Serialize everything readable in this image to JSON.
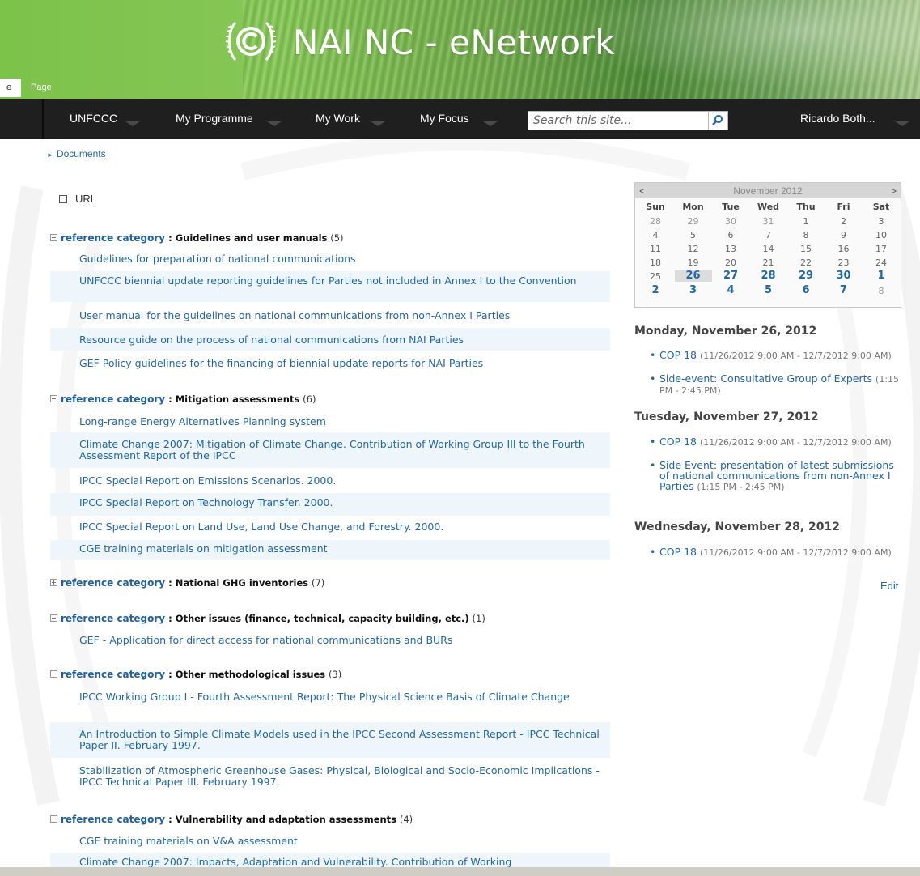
{
  "site": {
    "title": "NAI NC - eNetwork",
    "ribbon_tab_left": "e",
    "ribbon_tab_page": "Page"
  },
  "nav": {
    "items": [
      {
        "label": "UNFCCC"
      },
      {
        "label": "My Programme"
      },
      {
        "label": "My Work"
      },
      {
        "label": "My Focus"
      }
    ],
    "search_placeholder": "Search this site...",
    "user": "Ricardo Both..."
  },
  "breadcrumb": "Documents",
  "filter": {
    "url_label": "URL"
  },
  "groups": [
    {
      "category_label": "reference category",
      "separator": " : ",
      "name": "Guidelines and user manuals",
      "count": "(5)",
      "expanded": true,
      "items": [
        "Guidelines for preparation of national communications",
        "UNFCCC biennial update reporting guidelines for Parties not included in Annex I to the Convention",
        "User manual for the guidelines on national communications from non-Annex I Parties",
        "Resource guide on the process of national communications from NAI Parties",
        "GEF Policy guidelines for the financing of biennial update reports for NAI Parties"
      ]
    },
    {
      "category_label": "reference category",
      "separator": " : ",
      "name": "Mitigation assessments",
      "count": "(6)",
      "expanded": true,
      "items": [
        "Long-range Energy Alternatives Planning system",
        "Climate Change 2007: Mitigation of Climate Change. Contribution of Working Group III to the Fourth Assessment Report of the IPCC",
        "IPCC Special Report on Emissions Scenarios. 2000.",
        "IPCC Special Report on Technology Transfer. 2000.",
        "IPCC Special Report on Land Use, Land Use Change, and Forestry. 2000.",
        "CGE training materials on mitigation assessment"
      ]
    },
    {
      "category_label": "reference category",
      "separator": " : ",
      "name": "National GHG inventories",
      "count": "(7)",
      "expanded": false,
      "items": []
    },
    {
      "category_label": "reference category",
      "separator": " : ",
      "name": "Other issues (finance, technical, capacity building, etc.)",
      "count": "(1)",
      "expanded": true,
      "items": [
        "GEF - Application for direct access for national communications and BURs"
      ]
    },
    {
      "category_label": "reference category",
      "separator": " : ",
      "name": "Other methodological issues",
      "count": "(3)",
      "expanded": true,
      "items": [
        "IPCC Working Group I - Fourth Assessment Report: The Physical Science Basis of Climate Change",
        "An Introduction to Simple Climate Models used in the IPCC Second Assessment Report - IPCC Technical Paper II. February 1997.",
        "Stabilization of Atmospheric Greenhouse Gases: Physical, Biological and Socio-Economic Implications - IPCC Technical Paper III. February 1997."
      ]
    },
    {
      "category_label": "reference category",
      "separator": " : ",
      "name": "Vulnerability and adaptation assessments",
      "count": "(4)",
      "expanded": true,
      "items": [
        "CGE training materials on V&A assessment",
        "Climate Change 2007: Impacts, Adaptation and Vulnerability. Contribution of Working"
      ]
    }
  ],
  "calendar": {
    "prev": "<",
    "next": ">",
    "month": "November 2012",
    "dow": [
      "Sun",
      "Mon",
      "Tue",
      "Wed",
      "Thu",
      "Fri",
      "Sat"
    ],
    "weeks": [
      [
        {
          "d": "28",
          "s": "other"
        },
        {
          "d": "29",
          "s": "other"
        },
        {
          "d": "30",
          "s": "other"
        },
        {
          "d": "31",
          "s": "other"
        },
        {
          "d": "1",
          "s": "normal"
        },
        {
          "d": "2",
          "s": "normal"
        },
        {
          "d": "3",
          "s": "normal"
        }
      ],
      [
        {
          "d": "4",
          "s": "normal"
        },
        {
          "d": "5",
          "s": "normal"
        },
        {
          "d": "6",
          "s": "normal"
        },
        {
          "d": "7",
          "s": "normal"
        },
        {
          "d": "8",
          "s": "normal"
        },
        {
          "d": "9",
          "s": "normal"
        },
        {
          "d": "10",
          "s": "normal"
        }
      ],
      [
        {
          "d": "11",
          "s": "normal"
        },
        {
          "d": "12",
          "s": "normal"
        },
        {
          "d": "13",
          "s": "normal"
        },
        {
          "d": "14",
          "s": "normal"
        },
        {
          "d": "15",
          "s": "normal"
        },
        {
          "d": "16",
          "s": "normal"
        },
        {
          "d": "17",
          "s": "normal"
        }
      ],
      [
        {
          "d": "18",
          "s": "normal"
        },
        {
          "d": "19",
          "s": "normal"
        },
        {
          "d": "20",
          "s": "normal"
        },
        {
          "d": "21",
          "s": "normal"
        },
        {
          "d": "22",
          "s": "normal"
        },
        {
          "d": "23",
          "s": "normal"
        },
        {
          "d": "24",
          "s": "normal"
        }
      ],
      [
        {
          "d": "25",
          "s": "normal"
        },
        {
          "d": "26",
          "s": "today"
        },
        {
          "d": "27",
          "s": "bold"
        },
        {
          "d": "28",
          "s": "bold"
        },
        {
          "d": "29",
          "s": "bold"
        },
        {
          "d": "30",
          "s": "bold"
        },
        {
          "d": "1",
          "s": "bold"
        }
      ],
      [
        {
          "d": "2",
          "s": "bold"
        },
        {
          "d": "3",
          "s": "bold"
        },
        {
          "d": "4",
          "s": "bold"
        },
        {
          "d": "5",
          "s": "bold"
        },
        {
          "d": "6",
          "s": "bold"
        },
        {
          "d": "7",
          "s": "bold"
        },
        {
          "d": "8",
          "s": "other"
        }
      ]
    ]
  },
  "agenda": [
    {
      "day": "Monday, November 26, 2012",
      "events": [
        {
          "title": "COP 18",
          "time": "(11/26/2012 9:00 AM - 12/7/2012 9:00 AM)"
        },
        {
          "title": "Side-event: Consultative Group of Experts",
          "time": "(1:15 PM - 2:45 PM)"
        }
      ]
    },
    {
      "day": "Tuesday, November 27, 2012",
      "events": [
        {
          "title": "COP 18",
          "time": "(11/26/2012 9:00 AM - 12/7/2012 9:00 AM)"
        },
        {
          "title": "Side Event: presentation of latest submissions of national communications from non-Annex I Parties",
          "time": "(1:15 PM - 2:45 PM)"
        }
      ]
    },
    {
      "day": "Wednesday, November 28, 2012",
      "events": [
        {
          "title": "COP 18",
          "time": "(11/26/2012 9:00 AM - 12/7/2012 9:00 AM)"
        }
      ]
    }
  ],
  "edit_label": "Edit"
}
